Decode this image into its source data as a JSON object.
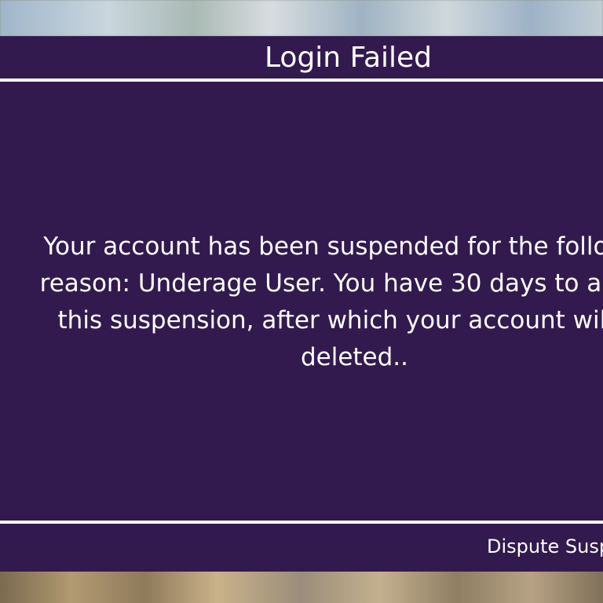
{
  "dialog": {
    "title": "Login Failed",
    "message": "Your account has been suspended for the following reason: Underage User. You have 30 days to appeal this suspension, after which your account will be deleted..",
    "dispute_button_label": "Dispute Suspension",
    "colors": {
      "panel": "#331a4e",
      "text": "#ffffff",
      "divider": "#ffffff"
    }
  }
}
